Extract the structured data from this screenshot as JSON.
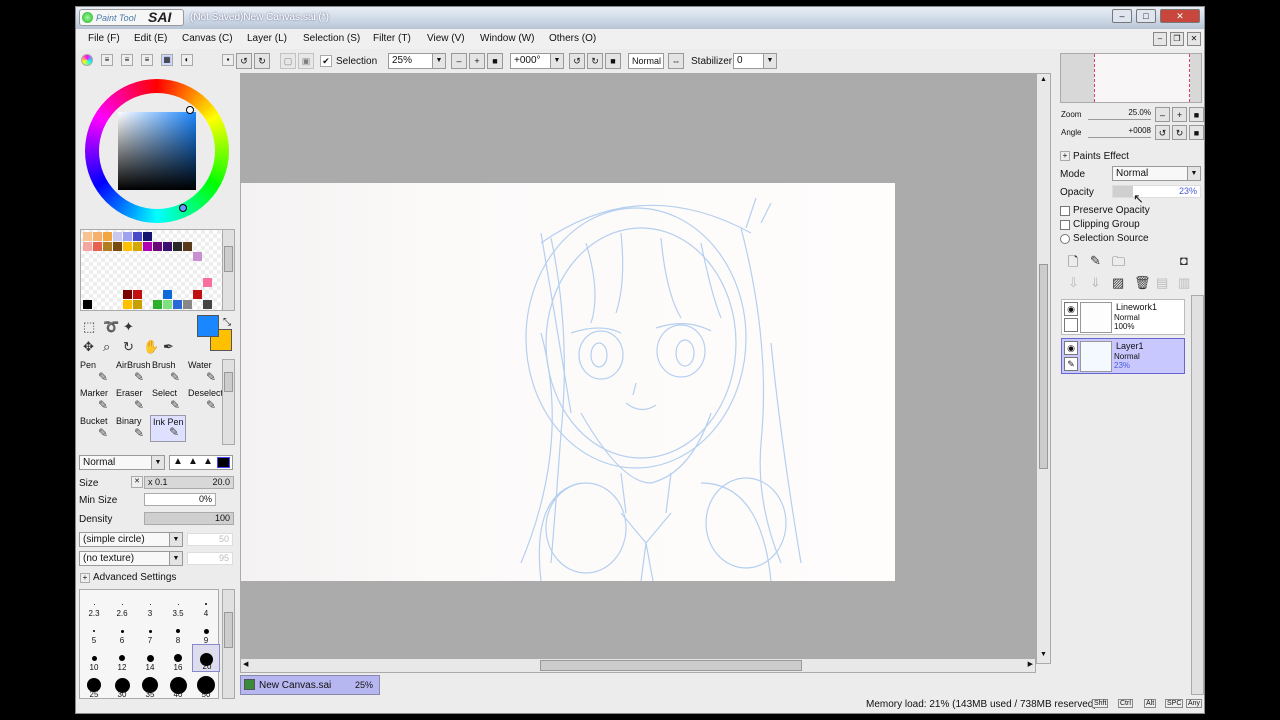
{
  "window": {
    "logo_text": "Paint Tool",
    "logo_sai": "SAI",
    "title": "(Not Saved)New Canvas.sai (*)"
  },
  "menu": [
    "File (F)",
    "Edit (E)",
    "Canvas (C)",
    "Layer (L)",
    "Selection (S)",
    "Filter (T)",
    "View (V)",
    "Window (W)",
    "Others (O)"
  ],
  "toolbar": {
    "selection_label": "Selection",
    "zoom_value": "25%",
    "rotation_value": "+000°",
    "blend_value": "Normal",
    "stabilizer_label": "Stabilizer",
    "stabilizer_value": "0"
  },
  "colors": {
    "primary": "#1a86ff",
    "secondary": "#ffc000"
  },
  "brush_tools": [
    {
      "label": "Pen",
      "icon": "pen-icon"
    },
    {
      "label": "AirBrush",
      "icon": "airbrush-icon"
    },
    {
      "label": "Brush",
      "icon": "brush-icon"
    },
    {
      "label": "Water",
      "icon": "water-icon"
    },
    {
      "label": "Marker",
      "icon": "marker-icon"
    },
    {
      "label": "Eraser",
      "icon": "eraser-icon"
    },
    {
      "label": "Select",
      "icon": "select-icon"
    },
    {
      "label": "Deselect",
      "icon": "deselect-icon"
    },
    {
      "label": "Bucket",
      "icon": "bucket-icon"
    },
    {
      "label": "Binary",
      "icon": "binary-icon"
    },
    {
      "label": "Ink Pen",
      "icon": "ink-pen-icon"
    }
  ],
  "brush_settings": {
    "blend_mode": "Normal",
    "size_label": "Size",
    "size_multiplier": "x 0.1",
    "size_value": "20.0",
    "min_size_label": "Min Size",
    "min_size_value": "0%",
    "density_label": "Density",
    "density_value": "100",
    "shape": "(simple circle)",
    "shape_value": "50",
    "texture": "(no texture)",
    "texture_value": "95",
    "advanced_label": "Advanced Settings"
  },
  "size_presets": [
    "2.3",
    "2.6",
    "3",
    "3.5",
    "4",
    "5",
    "6",
    "7",
    "8",
    "9",
    "10",
    "12",
    "14",
    "16",
    "20",
    "25",
    "30",
    "35",
    "40",
    "50"
  ],
  "navigator": {
    "zoom_label": "Zoom",
    "zoom_value": "25.0%",
    "angle_label": "Angle",
    "angle_value": "+0008"
  },
  "layer_props": {
    "paints_effect": "Paints Effect",
    "mode_label": "Mode",
    "mode_value": "Normal",
    "opacity_label": "Opacity",
    "opacity_value": "23%",
    "preserve_opacity": "Preserve Opacity",
    "clipping_group": "Clipping Group",
    "selection_source": "Selection Source"
  },
  "layers": [
    {
      "name": "Linework1",
      "mode": "Normal",
      "opacity": "100%",
      "selected": false
    },
    {
      "name": "Layer1",
      "mode": "Normal",
      "opacity": "23%",
      "selected": true
    }
  ],
  "doc_tab": {
    "name": "New Canvas.sai",
    "zoom": "25%"
  },
  "status": {
    "memory": "Memory load: 21% (143MB used / 738MB reserved)"
  },
  "keys": [
    "Shft",
    "Ctrl",
    "Alt",
    "SPC",
    "Any"
  ]
}
